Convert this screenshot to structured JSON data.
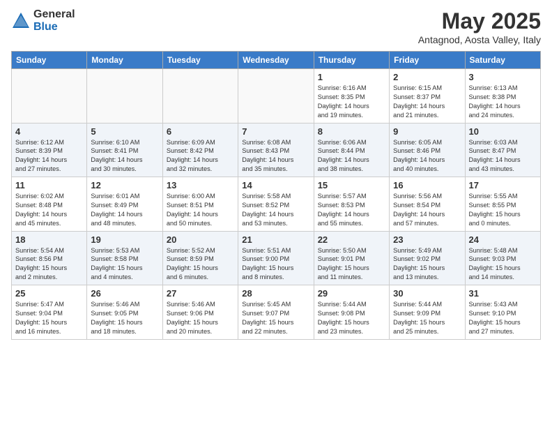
{
  "logo": {
    "general": "General",
    "blue": "Blue"
  },
  "title": "May 2025",
  "subtitle": "Antagnod, Aosta Valley, Italy",
  "weekdays": [
    "Sunday",
    "Monday",
    "Tuesday",
    "Wednesday",
    "Thursday",
    "Friday",
    "Saturday"
  ],
  "weeks": [
    [
      {
        "day": "",
        "info": ""
      },
      {
        "day": "",
        "info": ""
      },
      {
        "day": "",
        "info": ""
      },
      {
        "day": "",
        "info": ""
      },
      {
        "day": "1",
        "info": "Sunrise: 6:16 AM\nSunset: 8:35 PM\nDaylight: 14 hours\nand 19 minutes."
      },
      {
        "day": "2",
        "info": "Sunrise: 6:15 AM\nSunset: 8:37 PM\nDaylight: 14 hours\nand 21 minutes."
      },
      {
        "day": "3",
        "info": "Sunrise: 6:13 AM\nSunset: 8:38 PM\nDaylight: 14 hours\nand 24 minutes."
      }
    ],
    [
      {
        "day": "4",
        "info": "Sunrise: 6:12 AM\nSunset: 8:39 PM\nDaylight: 14 hours\nand 27 minutes."
      },
      {
        "day": "5",
        "info": "Sunrise: 6:10 AM\nSunset: 8:41 PM\nDaylight: 14 hours\nand 30 minutes."
      },
      {
        "day": "6",
        "info": "Sunrise: 6:09 AM\nSunset: 8:42 PM\nDaylight: 14 hours\nand 32 minutes."
      },
      {
        "day": "7",
        "info": "Sunrise: 6:08 AM\nSunset: 8:43 PM\nDaylight: 14 hours\nand 35 minutes."
      },
      {
        "day": "8",
        "info": "Sunrise: 6:06 AM\nSunset: 8:44 PM\nDaylight: 14 hours\nand 38 minutes."
      },
      {
        "day": "9",
        "info": "Sunrise: 6:05 AM\nSunset: 8:46 PM\nDaylight: 14 hours\nand 40 minutes."
      },
      {
        "day": "10",
        "info": "Sunrise: 6:03 AM\nSunset: 8:47 PM\nDaylight: 14 hours\nand 43 minutes."
      }
    ],
    [
      {
        "day": "11",
        "info": "Sunrise: 6:02 AM\nSunset: 8:48 PM\nDaylight: 14 hours\nand 45 minutes."
      },
      {
        "day": "12",
        "info": "Sunrise: 6:01 AM\nSunset: 8:49 PM\nDaylight: 14 hours\nand 48 minutes."
      },
      {
        "day": "13",
        "info": "Sunrise: 6:00 AM\nSunset: 8:51 PM\nDaylight: 14 hours\nand 50 minutes."
      },
      {
        "day": "14",
        "info": "Sunrise: 5:58 AM\nSunset: 8:52 PM\nDaylight: 14 hours\nand 53 minutes."
      },
      {
        "day": "15",
        "info": "Sunrise: 5:57 AM\nSunset: 8:53 PM\nDaylight: 14 hours\nand 55 minutes."
      },
      {
        "day": "16",
        "info": "Sunrise: 5:56 AM\nSunset: 8:54 PM\nDaylight: 14 hours\nand 57 minutes."
      },
      {
        "day": "17",
        "info": "Sunrise: 5:55 AM\nSunset: 8:55 PM\nDaylight: 15 hours\nand 0 minutes."
      }
    ],
    [
      {
        "day": "18",
        "info": "Sunrise: 5:54 AM\nSunset: 8:56 PM\nDaylight: 15 hours\nand 2 minutes."
      },
      {
        "day": "19",
        "info": "Sunrise: 5:53 AM\nSunset: 8:58 PM\nDaylight: 15 hours\nand 4 minutes."
      },
      {
        "day": "20",
        "info": "Sunrise: 5:52 AM\nSunset: 8:59 PM\nDaylight: 15 hours\nand 6 minutes."
      },
      {
        "day": "21",
        "info": "Sunrise: 5:51 AM\nSunset: 9:00 PM\nDaylight: 15 hours\nand 8 minutes."
      },
      {
        "day": "22",
        "info": "Sunrise: 5:50 AM\nSunset: 9:01 PM\nDaylight: 15 hours\nand 11 minutes."
      },
      {
        "day": "23",
        "info": "Sunrise: 5:49 AM\nSunset: 9:02 PM\nDaylight: 15 hours\nand 13 minutes."
      },
      {
        "day": "24",
        "info": "Sunrise: 5:48 AM\nSunset: 9:03 PM\nDaylight: 15 hours\nand 14 minutes."
      }
    ],
    [
      {
        "day": "25",
        "info": "Sunrise: 5:47 AM\nSunset: 9:04 PM\nDaylight: 15 hours\nand 16 minutes."
      },
      {
        "day": "26",
        "info": "Sunrise: 5:46 AM\nSunset: 9:05 PM\nDaylight: 15 hours\nand 18 minutes."
      },
      {
        "day": "27",
        "info": "Sunrise: 5:46 AM\nSunset: 9:06 PM\nDaylight: 15 hours\nand 20 minutes."
      },
      {
        "day": "28",
        "info": "Sunrise: 5:45 AM\nSunset: 9:07 PM\nDaylight: 15 hours\nand 22 minutes."
      },
      {
        "day": "29",
        "info": "Sunrise: 5:44 AM\nSunset: 9:08 PM\nDaylight: 15 hours\nand 23 minutes."
      },
      {
        "day": "30",
        "info": "Sunrise: 5:44 AM\nSunset: 9:09 PM\nDaylight: 15 hours\nand 25 minutes."
      },
      {
        "day": "31",
        "info": "Sunrise: 5:43 AM\nSunset: 9:10 PM\nDaylight: 15 hours\nand 27 minutes."
      }
    ]
  ]
}
